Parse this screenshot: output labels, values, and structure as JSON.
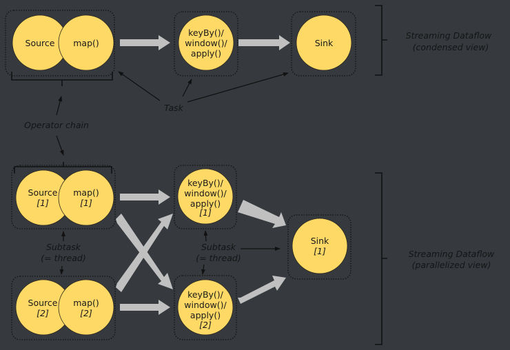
{
  "condensed": {
    "source": "Source",
    "map": "map()",
    "window": [
      "keyBy()/",
      "window()/",
      "apply()"
    ],
    "sink": "Sink",
    "label": [
      "Streaming Dataflow",
      "(condensed view)"
    ]
  },
  "annotations": {
    "task": "Task",
    "operator_chain": "Operator chain",
    "subtask": [
      "Subtask",
      "(= thread)"
    ]
  },
  "parallel": {
    "source1": [
      "Source",
      "[1]"
    ],
    "map1": [
      "map()",
      "[1]"
    ],
    "source2": [
      "Source",
      "[2]"
    ],
    "map2": [
      "map()",
      "[2]"
    ],
    "window1": [
      "keyBy()/",
      "window()/",
      "apply()",
      "[1]"
    ],
    "window2": [
      "keyBy()/",
      "window()/",
      "apply()",
      "[2]"
    ],
    "sink1": [
      "Sink",
      "[1]"
    ],
    "label": [
      "Streaming Dataflow",
      "(parallelized view)"
    ]
  },
  "colors": {
    "background": "#363a3f",
    "operator": "#ffd966",
    "flow_arrow": "#c0c0c0"
  }
}
